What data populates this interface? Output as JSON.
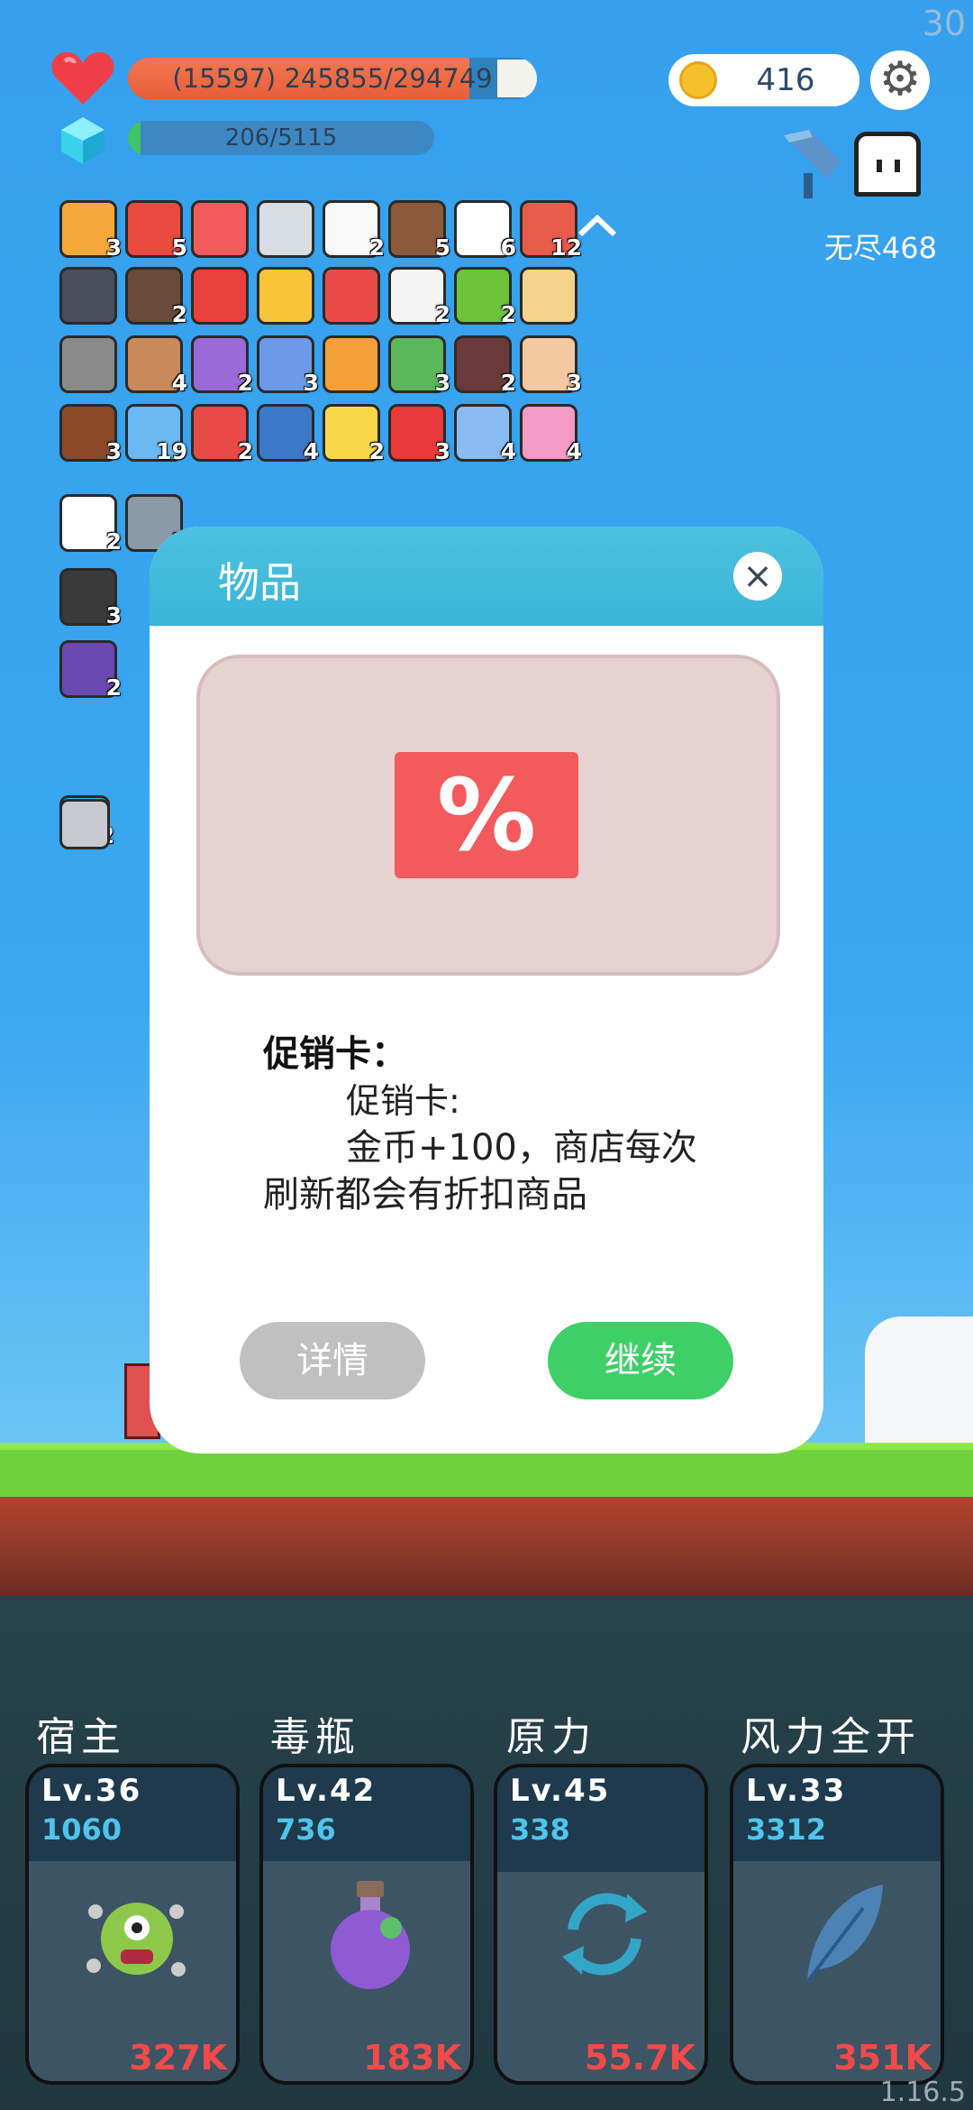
{
  "hud": {
    "fps": "30",
    "hp_text": "(15597) 245855/294749",
    "hp_fraction": 0.834,
    "xp_text": "206/5115",
    "xp_fraction": 0.04,
    "coins": "416",
    "endless_label": "无尽468",
    "version": "1.16.5"
  },
  "items": [
    {
      "icon": "book-icon",
      "count": "3"
    },
    {
      "icon": "sock-icon",
      "count": "5"
    },
    {
      "icon": "sale-card-icon",
      "count": ""
    },
    {
      "icon": "sword-icon",
      "count": ""
    },
    {
      "icon": "flower-icon",
      "count": "2"
    },
    {
      "icon": "coconut-icon",
      "count": "5"
    },
    {
      "icon": "cloud-icon",
      "count": "6"
    },
    {
      "icon": "watermelon-icon",
      "count": "12"
    },
    {
      "icon": "hood-icon",
      "count": ""
    },
    {
      "icon": "door-icon",
      "count": "2"
    },
    {
      "icon": "bookmark-icon",
      "count": ""
    },
    {
      "icon": "sun-icon",
      "count": ""
    },
    {
      "icon": "sneaker-icon",
      "count": ""
    },
    {
      "icon": "clipboard-icon",
      "count": "2"
    },
    {
      "icon": "lime-icon",
      "count": "2"
    },
    {
      "icon": "map-icon",
      "count": ""
    },
    {
      "icon": "helmet-icon",
      "count": ""
    },
    {
      "icon": "shield-round-icon",
      "count": "4"
    },
    {
      "icon": "star-shield-icon",
      "count": "2"
    },
    {
      "icon": "pill-icon",
      "count": "3"
    },
    {
      "icon": "crown-icon",
      "count": ""
    },
    {
      "icon": "zombie-icon",
      "count": "3"
    },
    {
      "icon": "jam-jar-icon",
      "count": "2"
    },
    {
      "icon": "hand-icon",
      "count": "3"
    },
    {
      "icon": "cake-flag-icon",
      "count": "3"
    },
    {
      "icon": "star-card-icon",
      "count": "19"
    },
    {
      "icon": "capsule-icon",
      "count": "2"
    },
    {
      "icon": "blue-shield-icon",
      "count": "4"
    },
    {
      "icon": "egg-icon",
      "count": "2"
    },
    {
      "icon": "mushroom-icon",
      "count": "3"
    },
    {
      "icon": "halo-mustache-icon",
      "count": "4"
    },
    {
      "icon": "ice-cream-icon",
      "count": "4"
    },
    {
      "icon": "ghost-icon",
      "count": "2"
    },
    {
      "icon": "compass-icon",
      "count": "2"
    },
    {
      "icon": "cauldron-icon",
      "count": "3"
    },
    {
      "icon": "purple-hat-icon",
      "count": "2"
    },
    {
      "icon": "blue-gem-icon",
      "count": "2"
    },
    {
      "icon": "katana-icon",
      "count": ""
    },
    {
      "icon": "monster-tile-icon",
      "count": ""
    }
  ],
  "dialog": {
    "title": "物品",
    "sale_glyph": "%",
    "item_name": "促销卡：",
    "desc_line1": "促销卡:",
    "desc_line2": "金币+100，商店每次",
    "desc_line3": "刷新都会有折扣商品",
    "details_label": "详情",
    "continue_label": "继续"
  },
  "skills": [
    {
      "name": "宿主",
      "level": "Lv.36",
      "cost": "1060",
      "damage": "327K",
      "icon": "virus-monster-icon"
    },
    {
      "name": "毒瓶",
      "level": "Lv.42",
      "cost": "736",
      "damage": "183K",
      "icon": "poison-flask-icon"
    },
    {
      "name": "原力",
      "level": "Lv.45",
      "cost": "338",
      "damage": "55.7K",
      "icon": "cycle-arrows-icon"
    },
    {
      "name": "风力全开",
      "level": "Lv.33",
      "cost": "3312",
      "damage": "351K",
      "icon": "feather-icon"
    }
  ]
}
